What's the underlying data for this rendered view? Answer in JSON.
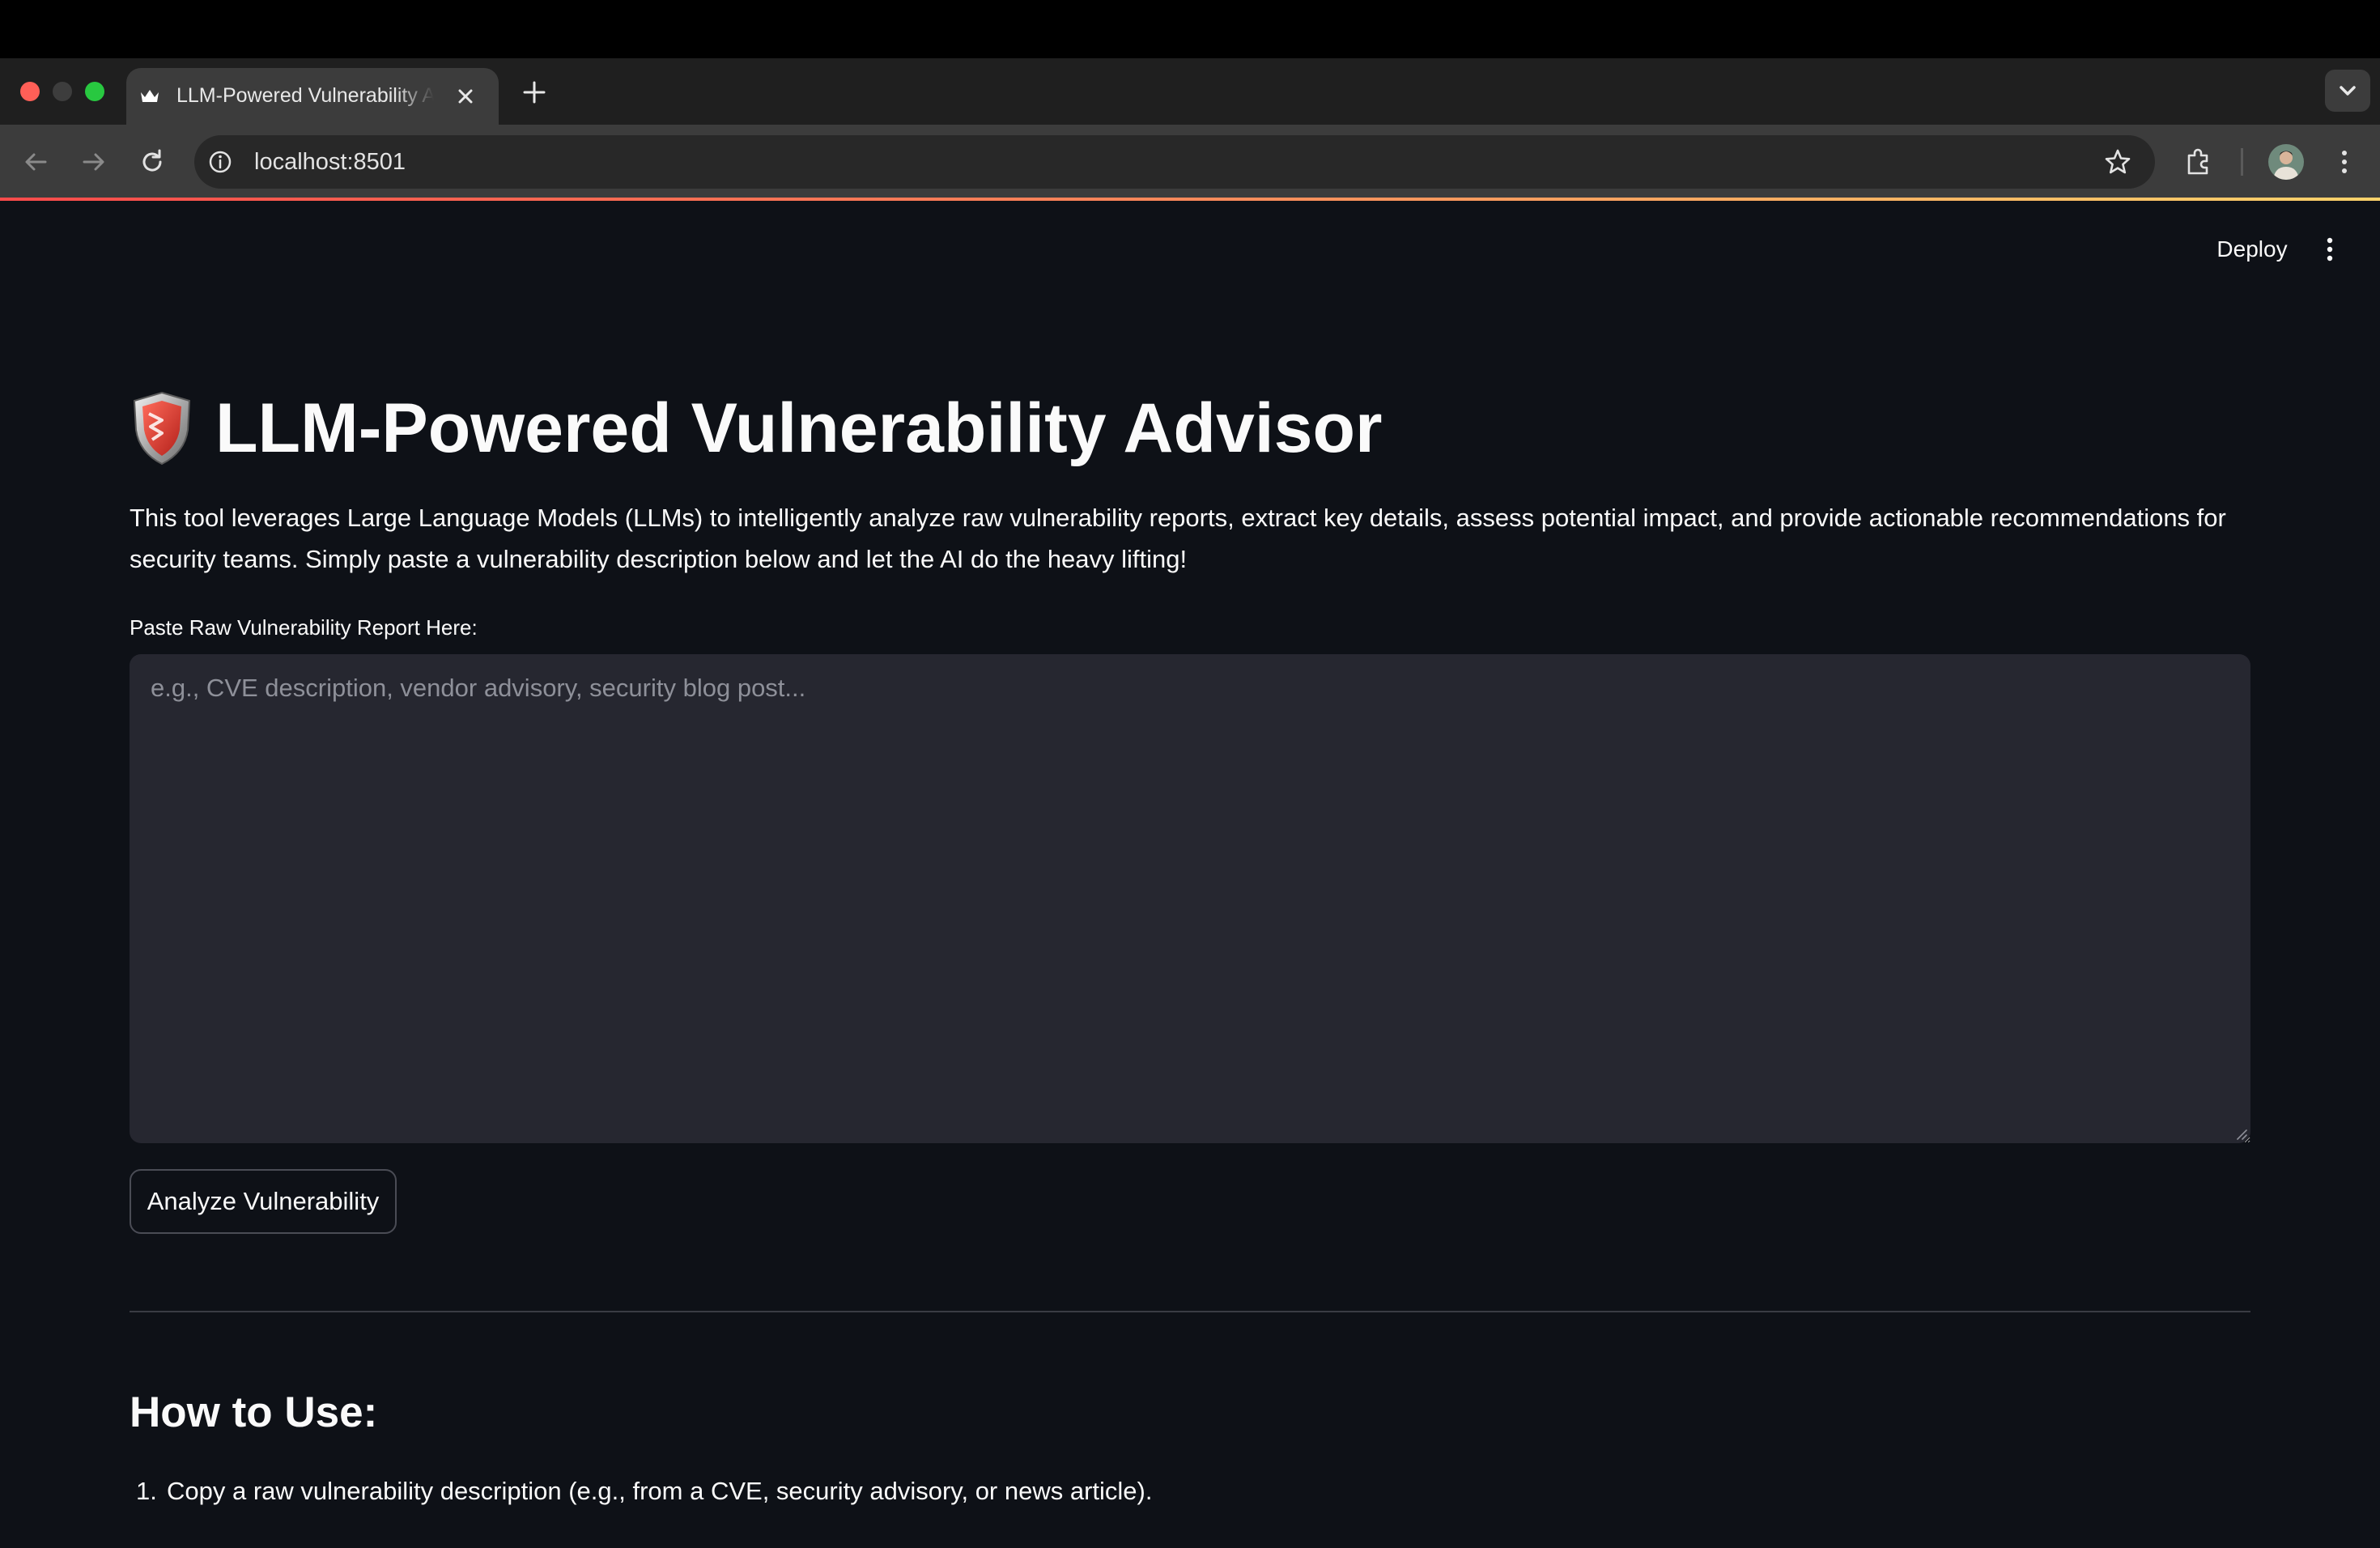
{
  "browser": {
    "tab": {
      "title": "LLM-Powered Vulnerability Advisor"
    },
    "address_bar": {
      "url": "localhost:8501"
    }
  },
  "app_header": {
    "deploy_label": "Deploy"
  },
  "main": {
    "title": "LLM-Powered Vulnerability Advisor",
    "intro": "This tool leverages Large Language Models (LLMs) to intelligently analyze raw vulnerability reports, extract key details, assess potential impact, and provide actionable recommendations for security teams. Simply paste a vulnerability description below and let the AI do the heavy lifting!",
    "report_input": {
      "label": "Paste Raw Vulnerability Report Here:",
      "value": "",
      "placeholder": "e.g., CVE description, vendor advisory, security blog post..."
    },
    "analyze_button_label": "Analyze Vulnerability",
    "how_to": {
      "heading": "How to Use:",
      "steps": [
        {
          "number": "1.",
          "text": "Copy a raw vulnerability description (e.g., from a CVE, security advisory, or news article)."
        }
      ]
    }
  },
  "colors": {
    "page_background": "#0e1117",
    "input_background": "#262730",
    "text": "#fafafa",
    "accent": "#ff4b4b"
  }
}
